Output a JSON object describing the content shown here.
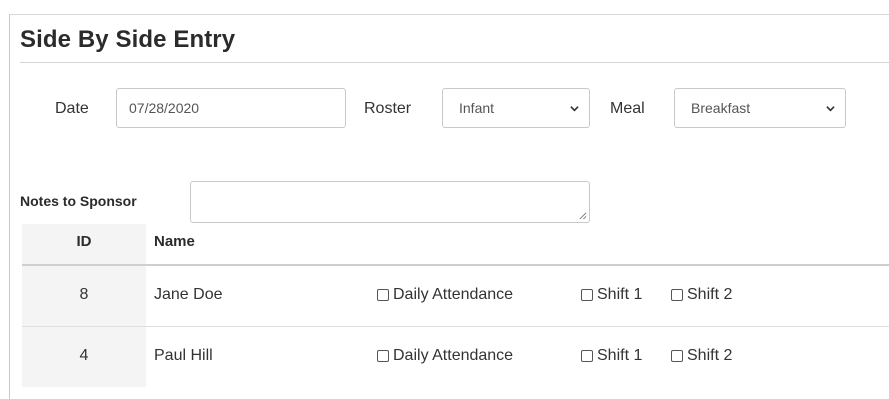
{
  "page": {
    "title": "Side By Side Entry"
  },
  "filters": {
    "date_label": "Date",
    "date_value": "07/28/2020",
    "roster_label": "Roster",
    "roster_selected": "Infant",
    "meal_label": "Meal",
    "meal_selected": "Breakfast"
  },
  "notes": {
    "label": "Notes to Sponsor",
    "value": ""
  },
  "table": {
    "headers": {
      "id": "ID",
      "name": "Name"
    },
    "checkbox_labels": {
      "daily_attendance": "Daily Attendance",
      "shift1": "Shift 1",
      "shift2": "Shift 2"
    },
    "rows": [
      {
        "id": "8",
        "name": "Jane Doe",
        "daily_attendance": false,
        "shift1": false,
        "shift2": false
      },
      {
        "id": "4",
        "name": "Paul Hill",
        "daily_attendance": false,
        "shift1": false,
        "shift2": false
      }
    ]
  },
  "icons": {
    "select_arrow": "chevron-down-icon",
    "textarea_resize": "resize-handle-icon",
    "checkbox": "checkbox-unchecked-icon"
  }
}
